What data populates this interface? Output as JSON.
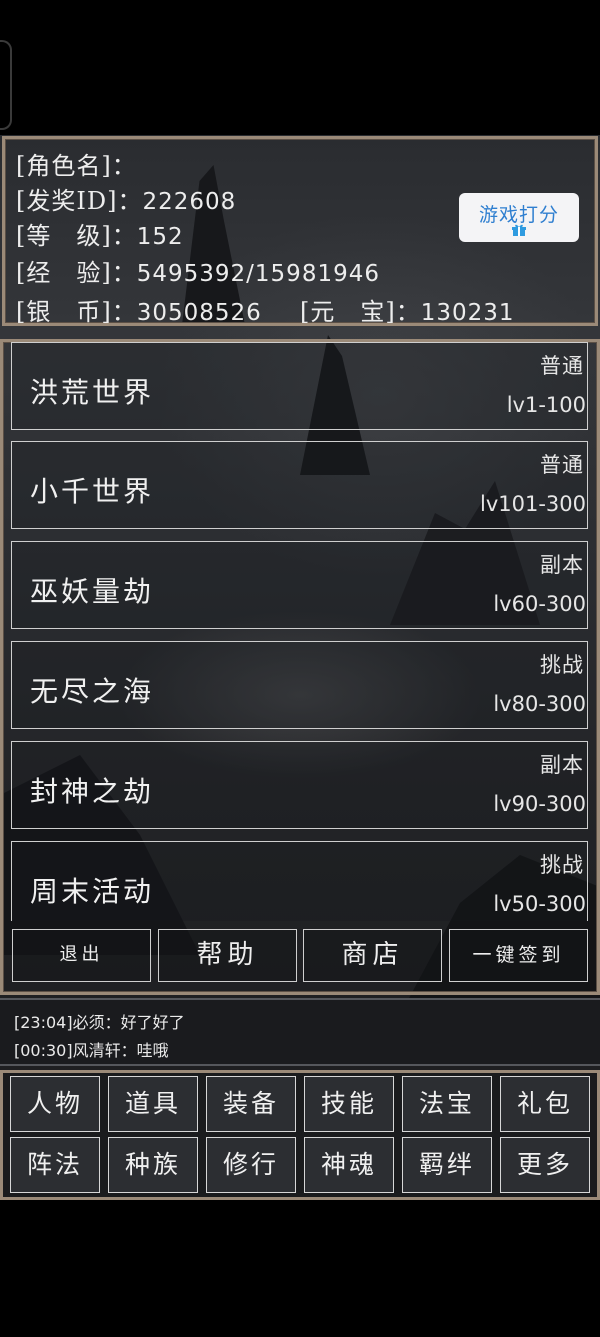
{
  "player": {
    "name_label": "[角色名]：",
    "name_value": "",
    "id_label": "[发奖ID]：",
    "id_value": "222608",
    "level_label": "[等　级]：",
    "level_value": "152",
    "exp_label": "[经　验]：",
    "exp_value": "5495392/15981946",
    "silver_label": "[银　币]：",
    "silver_value": "30508526",
    "ingot_label": "[元　宝]：",
    "ingot_value": "130231"
  },
  "rate_button": {
    "label": "游戏打分",
    "icon": "gift-icon"
  },
  "maps": [
    {
      "name": "洪荒世界",
      "type": "普通",
      "level": "lv1-100"
    },
    {
      "name": "小千世界",
      "type": "普通",
      "level": "lv101-300"
    },
    {
      "name": "巫妖量劫",
      "type": "副本",
      "level": "lv60-300"
    },
    {
      "name": "无尽之海",
      "type": "挑战",
      "level": "lv80-300"
    },
    {
      "name": "封神之劫",
      "type": "副本",
      "level": "lv90-300"
    },
    {
      "name": "周末活动",
      "type": "挑战",
      "level": "lv50-300"
    }
  ],
  "actions": {
    "exit": "退出",
    "help": "帮助",
    "shop": "商店",
    "checkin": "一键签到"
  },
  "chat": [
    {
      "text": "[23:04]必须：好了好了"
    },
    {
      "text": "[00:30]风清轩：哇哦"
    }
  ],
  "menu": {
    "row1": [
      "人物",
      "道具",
      "装备",
      "技能",
      "法宝",
      "礼包"
    ],
    "row2": [
      "阵法",
      "种族",
      "修行",
      "神魂",
      "羁绊",
      "更多"
    ]
  },
  "colors": {
    "frame": "#9b8a78",
    "rate_text": "#2f7fd0",
    "background": "#000000"
  }
}
